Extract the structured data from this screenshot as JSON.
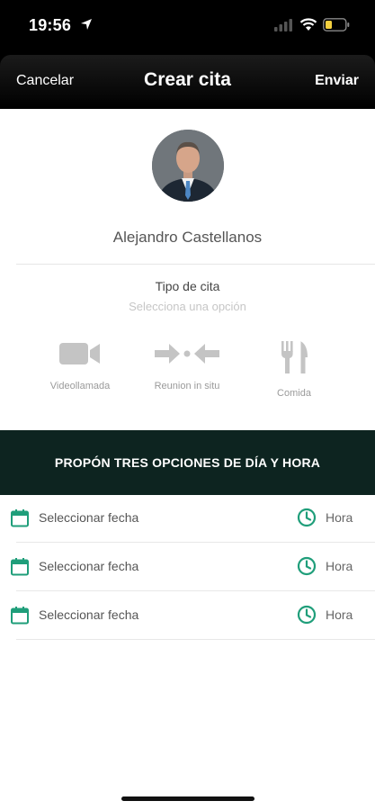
{
  "status_bar": {
    "time": "19:56"
  },
  "header": {
    "cancel_label": "Cancelar",
    "title": "Crear cita",
    "send_label": "Enviar"
  },
  "contact": {
    "name": "Alejandro Castellanos"
  },
  "appointment_type": {
    "title": "Tipo de cita",
    "placeholder": "Selecciona una opción",
    "options": [
      {
        "label": "Videollamada",
        "icon": "video-camera-icon"
      },
      {
        "label": "Reunion in situ",
        "icon": "meeting-arrows-icon"
      },
      {
        "label": "Comida",
        "icon": "fork-knife-icon"
      }
    ]
  },
  "schedule": {
    "banner": "PROPÓN TRES OPCIONES DE DÍA Y HORA",
    "rows": [
      {
        "date_label": "Seleccionar fecha",
        "time_label": "Hora"
      },
      {
        "date_label": "Seleccionar fecha",
        "time_label": "Hora"
      },
      {
        "date_label": "Seleccionar fecha",
        "time_label": "Hora"
      }
    ]
  },
  "colors": {
    "accent_green": "#1f9e7a",
    "banner_bg": "#0d2420",
    "icon_gray": "#c4c4c4"
  }
}
